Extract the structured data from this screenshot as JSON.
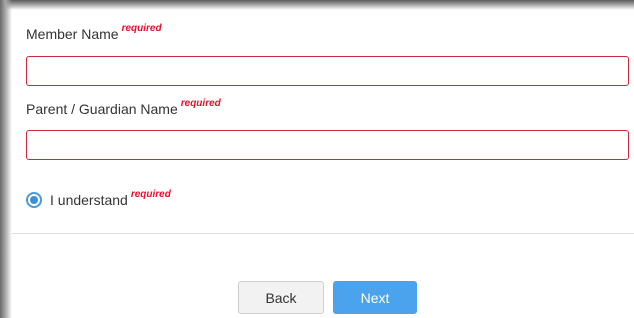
{
  "form": {
    "member_name": {
      "label": "Member Name",
      "required_tag": "required",
      "value": ""
    },
    "guardian_name": {
      "label": "Parent / Guardian Name",
      "required_tag": "required",
      "value": ""
    },
    "understand": {
      "label": "I understand",
      "required_tag": "required",
      "selected": true
    }
  },
  "buttons": {
    "back_label": "Back",
    "next_label": "Next"
  },
  "colors": {
    "required_text": "#e0112b",
    "input_border_error": "#d0273a",
    "primary_button": "#4aa3ec",
    "radio_accent": "#3d8fd6"
  },
  "icons": {
    "radio": "radio-selected-icon"
  }
}
